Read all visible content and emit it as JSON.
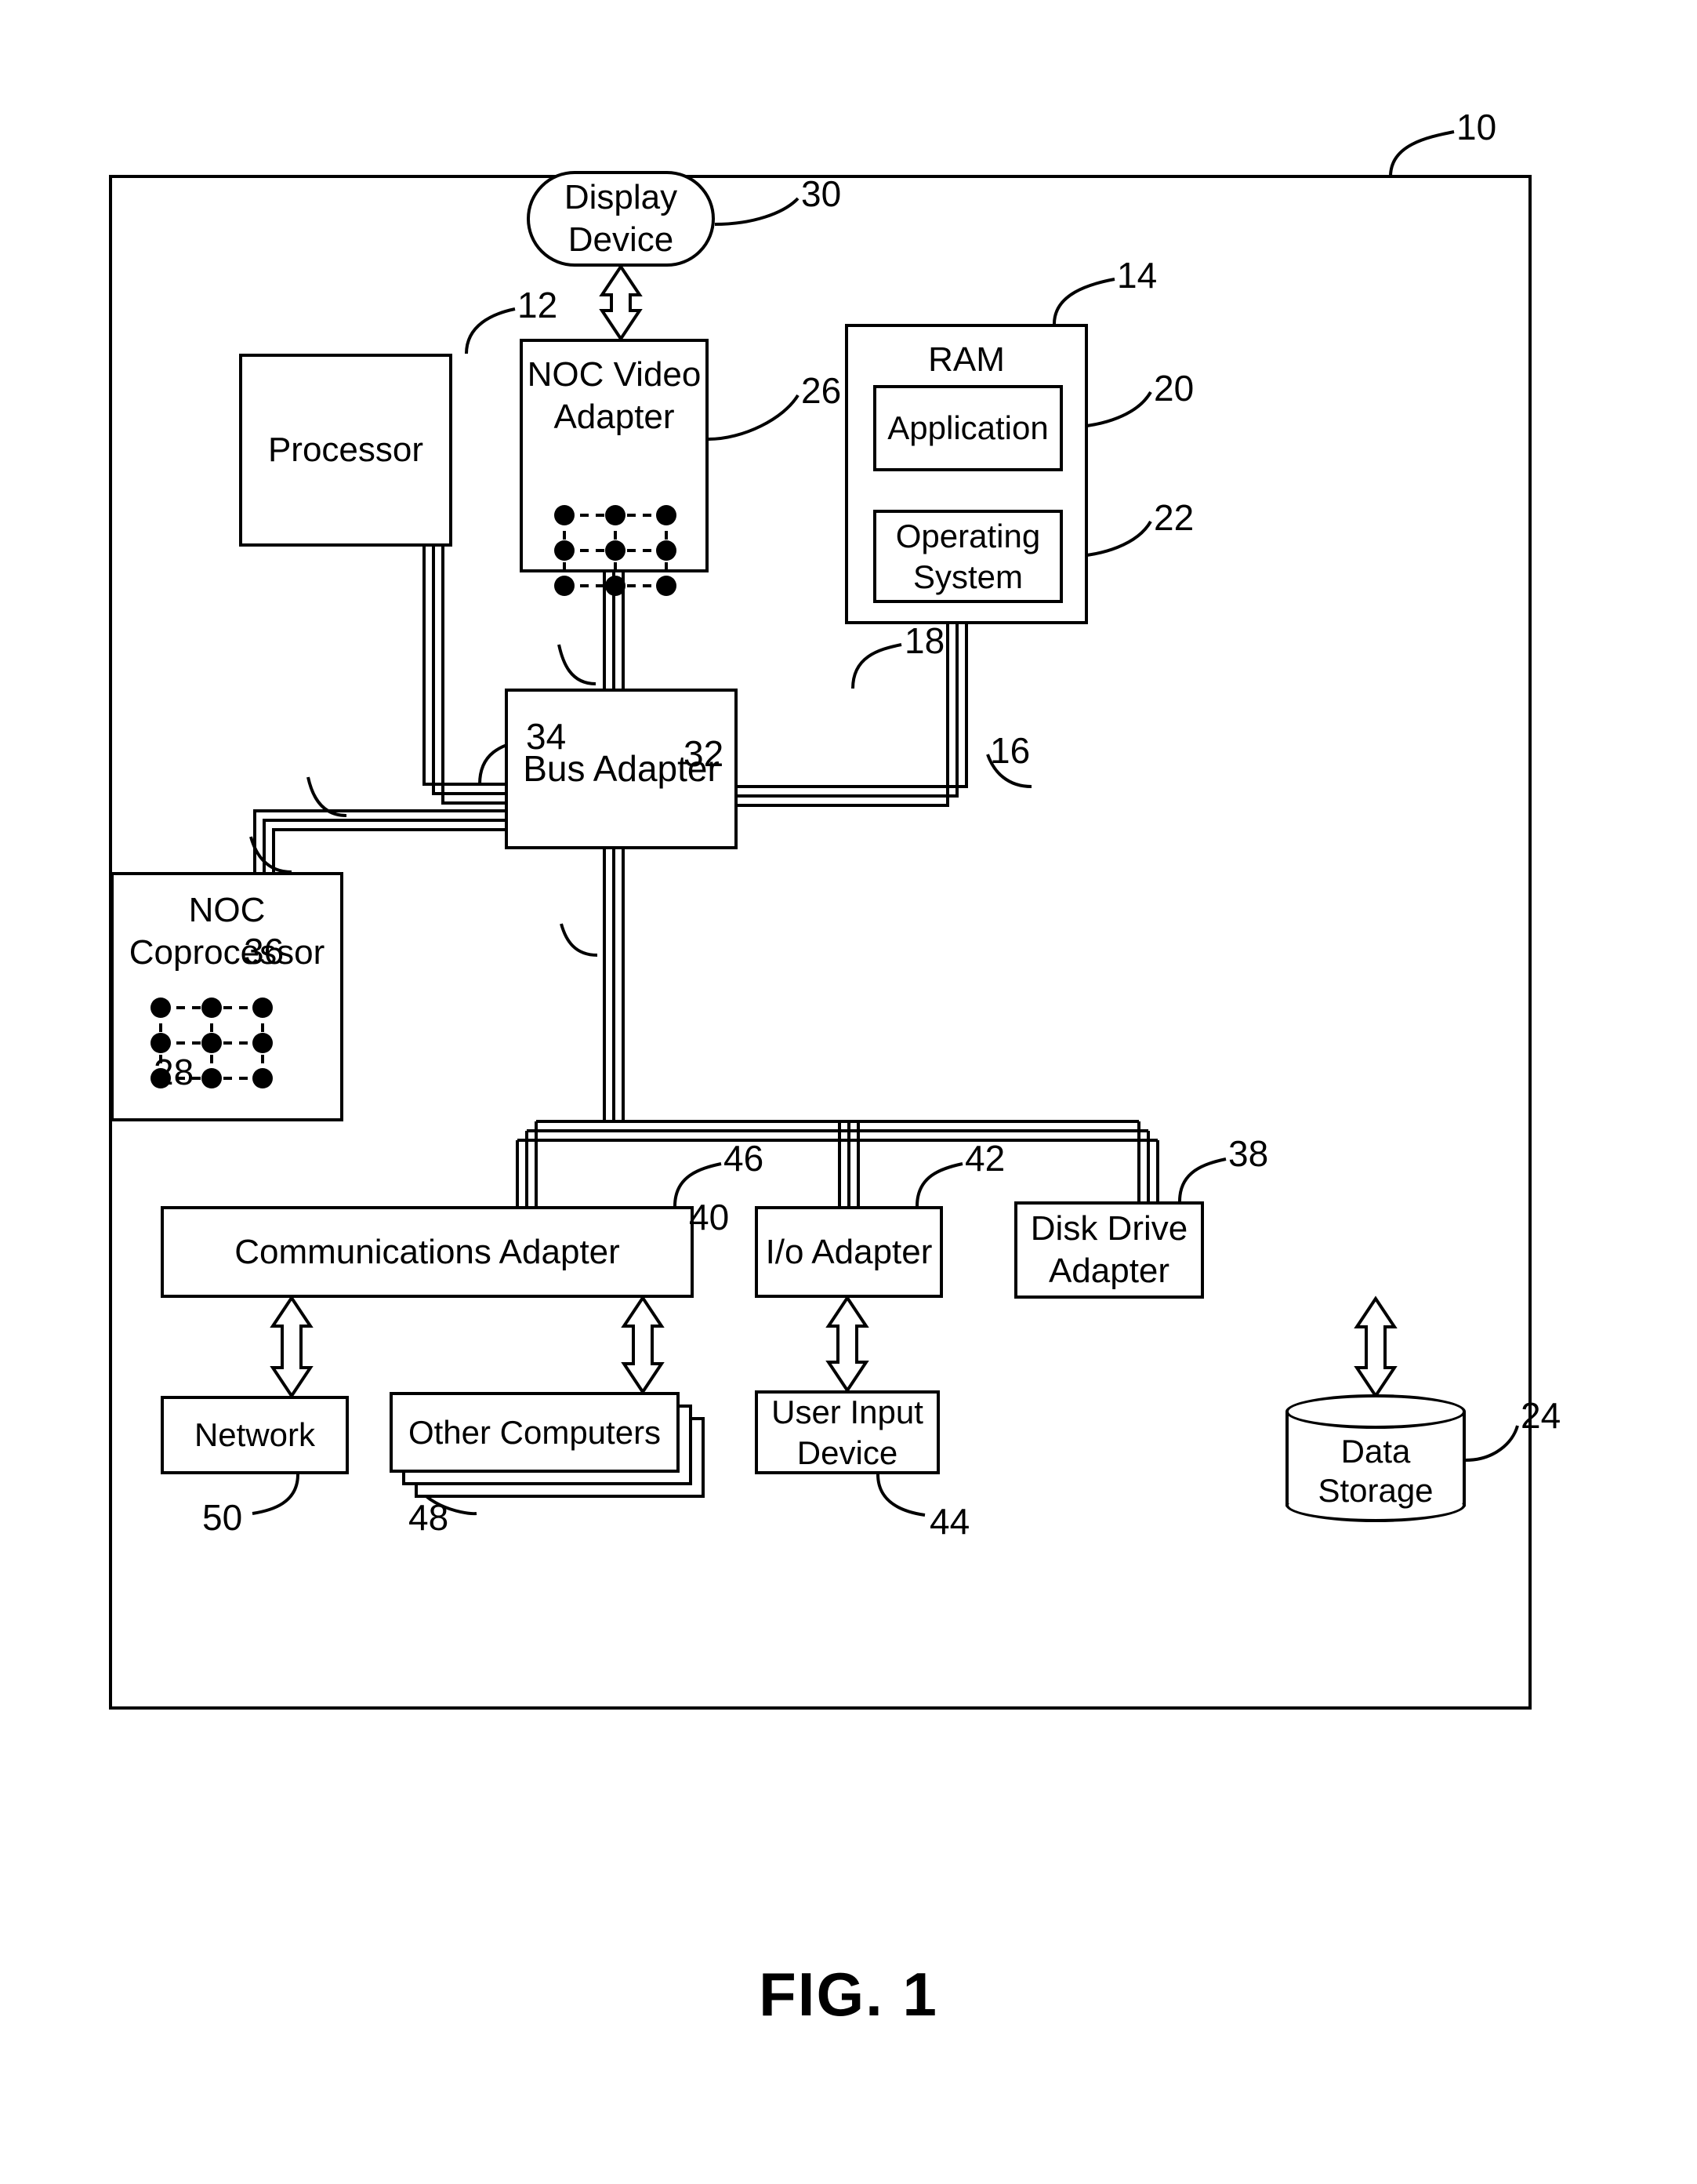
{
  "figure": {
    "caption": "FIG. 1",
    "system_ref": "10"
  },
  "nodes": {
    "display_device": {
      "label": "Display\nDevice",
      "ref": "30"
    },
    "noc_video_adapter": {
      "label": "NOC Video\nAdapter",
      "ref": "26"
    },
    "processor": {
      "label": "Processor",
      "ref": "12"
    },
    "ram": {
      "label": "RAM",
      "ref": "14"
    },
    "application": {
      "label": "Application",
      "ref": "20"
    },
    "operating_system": {
      "label": "Operating\nSystem",
      "ref": "22"
    },
    "bus_adapter": {
      "label": "Bus Adapter",
      "ref": "18"
    },
    "noc_coprocessor": {
      "label": "NOC\nCoprocessor",
      "ref": "28"
    },
    "communications_adapter": {
      "label": "Communications Adapter",
      "ref": "46"
    },
    "io_adapter": {
      "label": "I/o Adapter",
      "ref": "42"
    },
    "disk_drive_adapter": {
      "label": "Disk Drive\nAdapter",
      "ref": "38"
    },
    "network": {
      "label": "Network",
      "ref": "50"
    },
    "other_computers": {
      "label": "Other Computers",
      "ref": "48"
    },
    "user_input_device": {
      "label": "User Input\nDevice",
      "ref": "44"
    },
    "data_storage": {
      "label": "Data\nStorage",
      "ref": "24"
    }
  },
  "connections": {
    "video_bus": {
      "ref": "32"
    },
    "processor_bus": {
      "ref": "34"
    },
    "coprocessor_bus": {
      "ref": "36"
    },
    "memory_bus": {
      "ref": "16"
    },
    "expansion_bus": {
      "ref": "40"
    }
  },
  "colors": {
    "line": "#000000",
    "background": "#ffffff"
  }
}
